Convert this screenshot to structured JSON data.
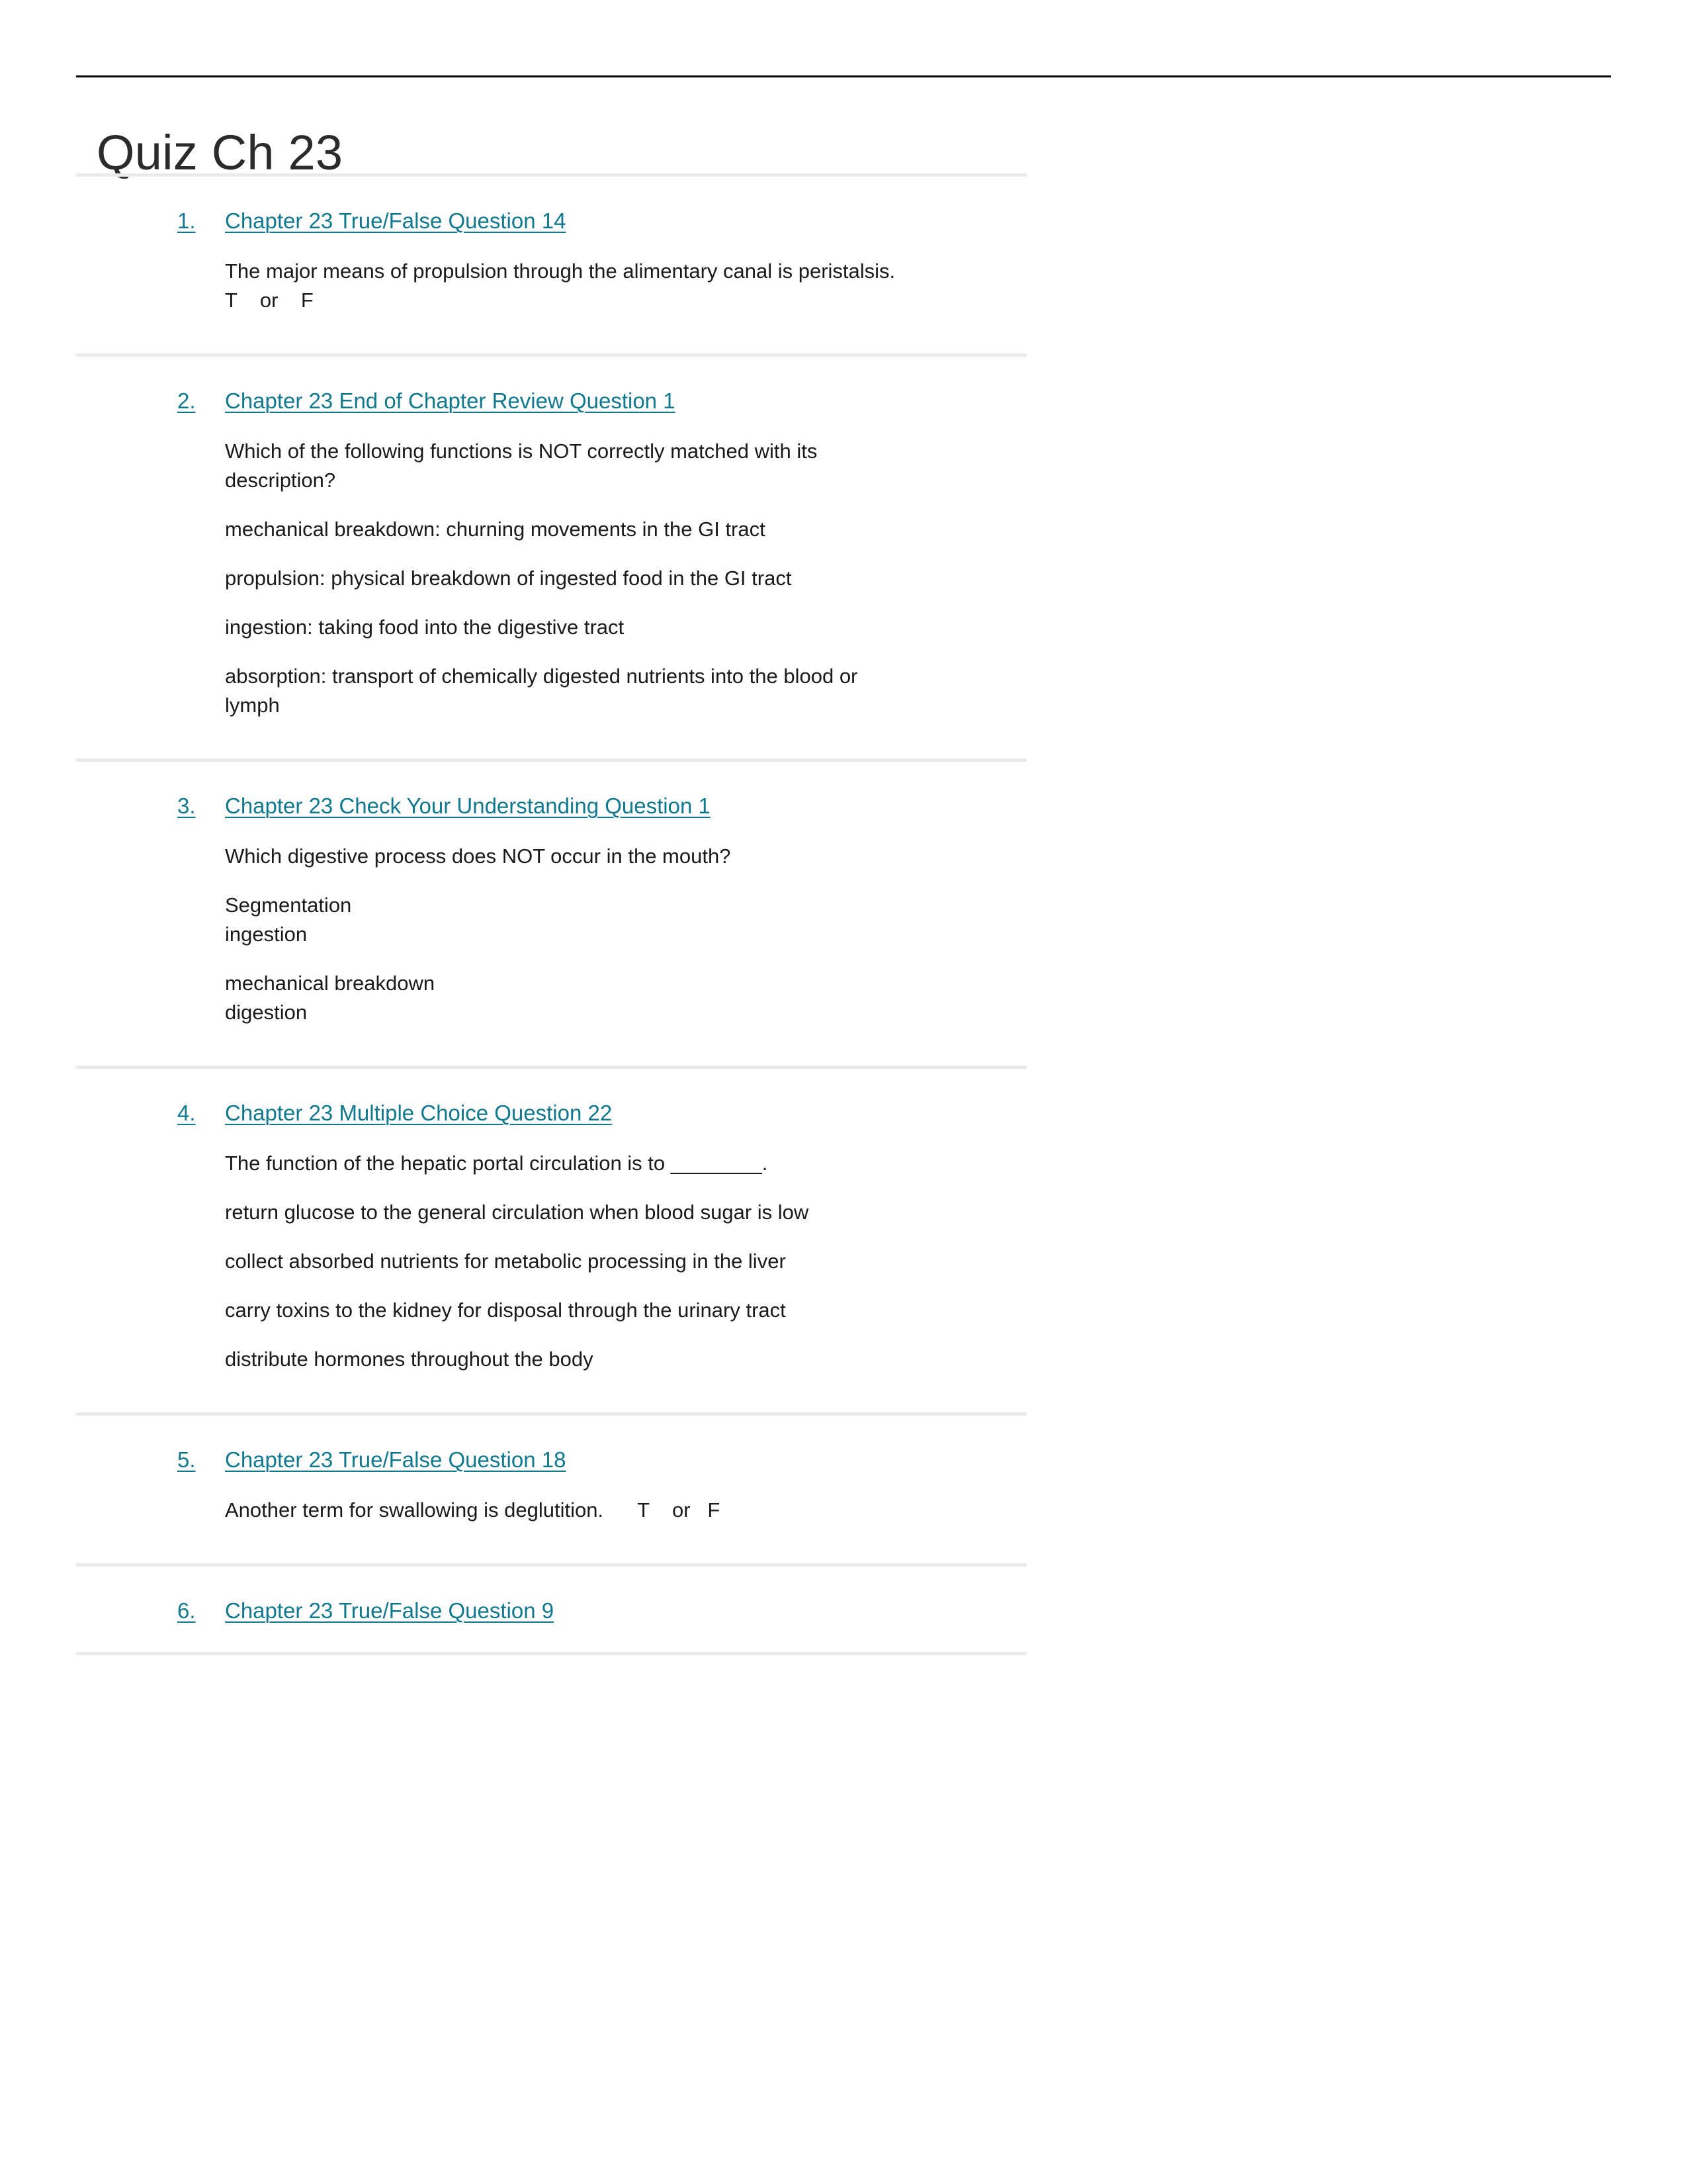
{
  "document": {
    "title": "Quiz Ch 23",
    "link_color": "#10788f",
    "text_color": "#1a1a1a",
    "rule_color": "#000000",
    "separator_color": "#ebebeb"
  },
  "questions": [
    {
      "number": "1.",
      "link": "Chapter 23 True/False Question 14",
      "paragraphs": [
        "The major means of propulsion through the alimentary canal is peristalsis.  T    or    F"
      ]
    },
    {
      "number": "2.",
      "link": "Chapter 23 End of Chapter Review Question 1",
      "paragraphs": [
        "Which of the following functions is NOT correctly matched with its description?",
        "mechanical breakdown: churning movements in the GI tract",
        "propulsion: physical breakdown of ingested food in the GI tract",
        "ingestion: taking food into the digestive tract",
        "absorption: transport of chemically digested nutrients into the blood or lymph"
      ]
    },
    {
      "number": "3.",
      "link": "Chapter 23 Check Your Understanding Question 1",
      "paragraphs": [
        "Which digestive process does NOT occur in the mouth?",
        "Segmentation\ningestion",
        "mechanical breakdown\ndigestion"
      ]
    },
    {
      "number": "4.",
      "link": "Chapter 23 Multiple Choice Question 22",
      "paragraphs": [
        "The function of the hepatic portal circulation is to ________.",
        "return glucose to the general circulation when blood sugar is low",
        "collect absorbed nutrients for metabolic processing in the liver",
        "carry toxins to the kidney for disposal through the urinary tract",
        "distribute hormones throughout the body"
      ]
    },
    {
      "number": "5.",
      "link": "Chapter 23 True/False Question 18",
      "paragraphs": [
        "Another term for swallowing is deglutition.      T    or   F"
      ]
    },
    {
      "number": "6.",
      "link": "Chapter 23 True/False Question 9",
      "paragraphs": []
    }
  ]
}
